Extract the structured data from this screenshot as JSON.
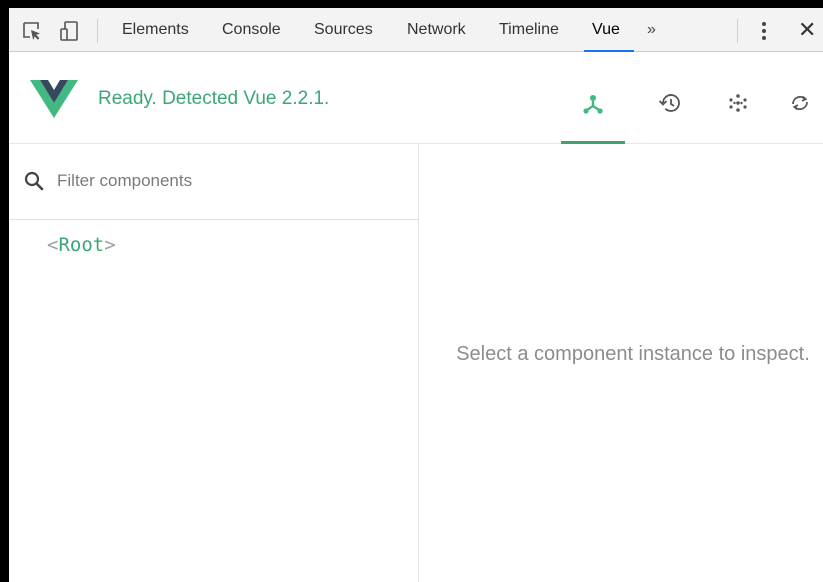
{
  "toolbar": {
    "tabs": [
      {
        "label": "Elements"
      },
      {
        "label": "Console"
      },
      {
        "label": "Sources"
      },
      {
        "label": "Network"
      },
      {
        "label": "Timeline"
      },
      {
        "label": "Vue",
        "active": true
      }
    ],
    "overflow_label": "»",
    "close_label": "✕",
    "icons": [
      "inspect-element-icon",
      "device-toggle-icon",
      "kebab-menu-icon"
    ]
  },
  "vue_header": {
    "status": "Ready. Detected Vue 2.2.1.",
    "brand_color": "#42b983",
    "buttons": [
      {
        "icon": "components-tree-icon",
        "active": true
      },
      {
        "icon": "history-icon",
        "active": false
      },
      {
        "icon": "vuex-dots-icon",
        "active": false
      },
      {
        "icon": "refresh-icon",
        "active": false
      }
    ]
  },
  "left_pane": {
    "filter_placeholder": "Filter components",
    "tree": [
      {
        "open": "<",
        "name": "Root",
        "close": ">"
      }
    ]
  },
  "right_pane": {
    "message": "Select a component instance to inspect."
  }
}
